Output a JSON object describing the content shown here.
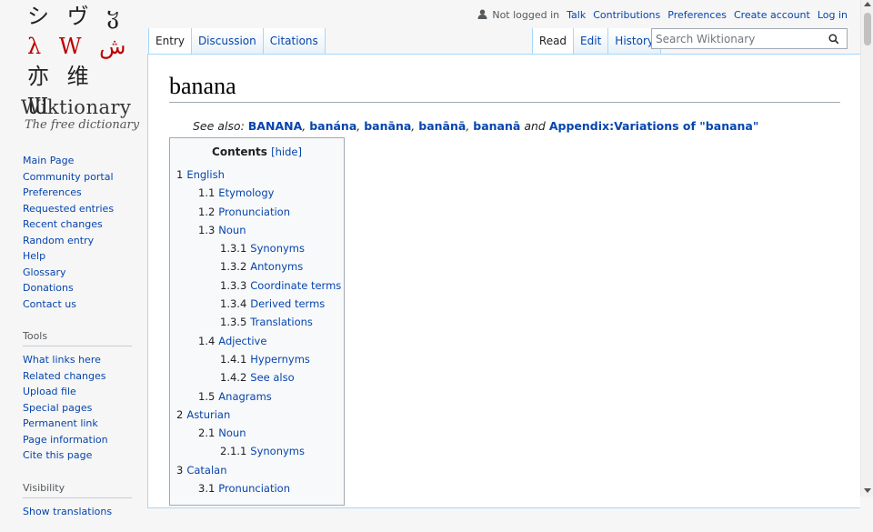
{
  "logo": {
    "glyph_rows": [
      "シ ヴ ჳ",
      "λ W ش",
      "亦 维 Ɯ"
    ],
    "wordmark": "Wiktionary",
    "tagline": "The free dictionary"
  },
  "personal": {
    "not_logged_in": "Not logged in",
    "talk": "Talk",
    "contributions": "Contributions",
    "preferences": "Preferences",
    "create_account": "Create account",
    "log_in": "Log in"
  },
  "tabs": {
    "entry": "Entry",
    "discussion": "Discussion",
    "citations": "Citations",
    "read": "Read",
    "edit": "Edit",
    "history": "History"
  },
  "search": {
    "placeholder": "Search Wiktionary"
  },
  "sidebar": {
    "nav": [
      "Main Page",
      "Community portal",
      "Preferences",
      "Requested entries",
      "Recent changes",
      "Random entry",
      "Help",
      "Glossary",
      "Donations",
      "Contact us"
    ],
    "tools_heading": "Tools",
    "tools": [
      "What links here",
      "Related changes",
      "Upload file",
      "Special pages",
      "Permanent link",
      "Page information",
      "Cite this page"
    ],
    "visibility_heading": "Visibility",
    "visibility": [
      "Show translations"
    ]
  },
  "page": {
    "title": "banana",
    "see_also_prefix": "See also: ",
    "see_also_links": [
      "BANANA",
      "banána",
      "banāna",
      "banānā",
      "bananā"
    ],
    "see_also_and": "and",
    "see_also_appendix": "Appendix:Variations of \"banana\""
  },
  "toc": {
    "title": "Contents",
    "hide": "[hide]",
    "items": [
      {
        "num": "1",
        "label": "English",
        "level": 1
      },
      {
        "num": "1.1",
        "label": "Etymology",
        "level": 2
      },
      {
        "num": "1.2",
        "label": "Pronunciation",
        "level": 2
      },
      {
        "num": "1.3",
        "label": "Noun",
        "level": 2
      },
      {
        "num": "1.3.1",
        "label": "Synonyms",
        "level": 3
      },
      {
        "num": "1.3.2",
        "label": "Antonyms",
        "level": 3
      },
      {
        "num": "1.3.3",
        "label": "Coordinate terms",
        "level": 3
      },
      {
        "num": "1.3.4",
        "label": "Derived terms",
        "level": 3
      },
      {
        "num": "1.3.5",
        "label": "Translations",
        "level": 3
      },
      {
        "num": "1.4",
        "label": "Adjective",
        "level": 2
      },
      {
        "num": "1.4.1",
        "label": "Hypernyms",
        "level": 3
      },
      {
        "num": "1.4.2",
        "label": "See also",
        "level": 3
      },
      {
        "num": "1.5",
        "label": "Anagrams",
        "level": 2
      },
      {
        "num": "2",
        "label": "Asturian",
        "level": 1
      },
      {
        "num": "2.1",
        "label": "Noun",
        "level": 2
      },
      {
        "num": "2.1.1",
        "label": "Synonyms",
        "level": 3
      },
      {
        "num": "3",
        "label": "Catalan",
        "level": 1
      },
      {
        "num": "3.1",
        "label": "Pronunciation",
        "level": 2
      }
    ]
  },
  "colors": {
    "link": "#0645ad",
    "tab_border": "#a7d7f9",
    "text": "#202122"
  },
  "icons": {
    "user": "user-icon",
    "search": "search-icon"
  }
}
